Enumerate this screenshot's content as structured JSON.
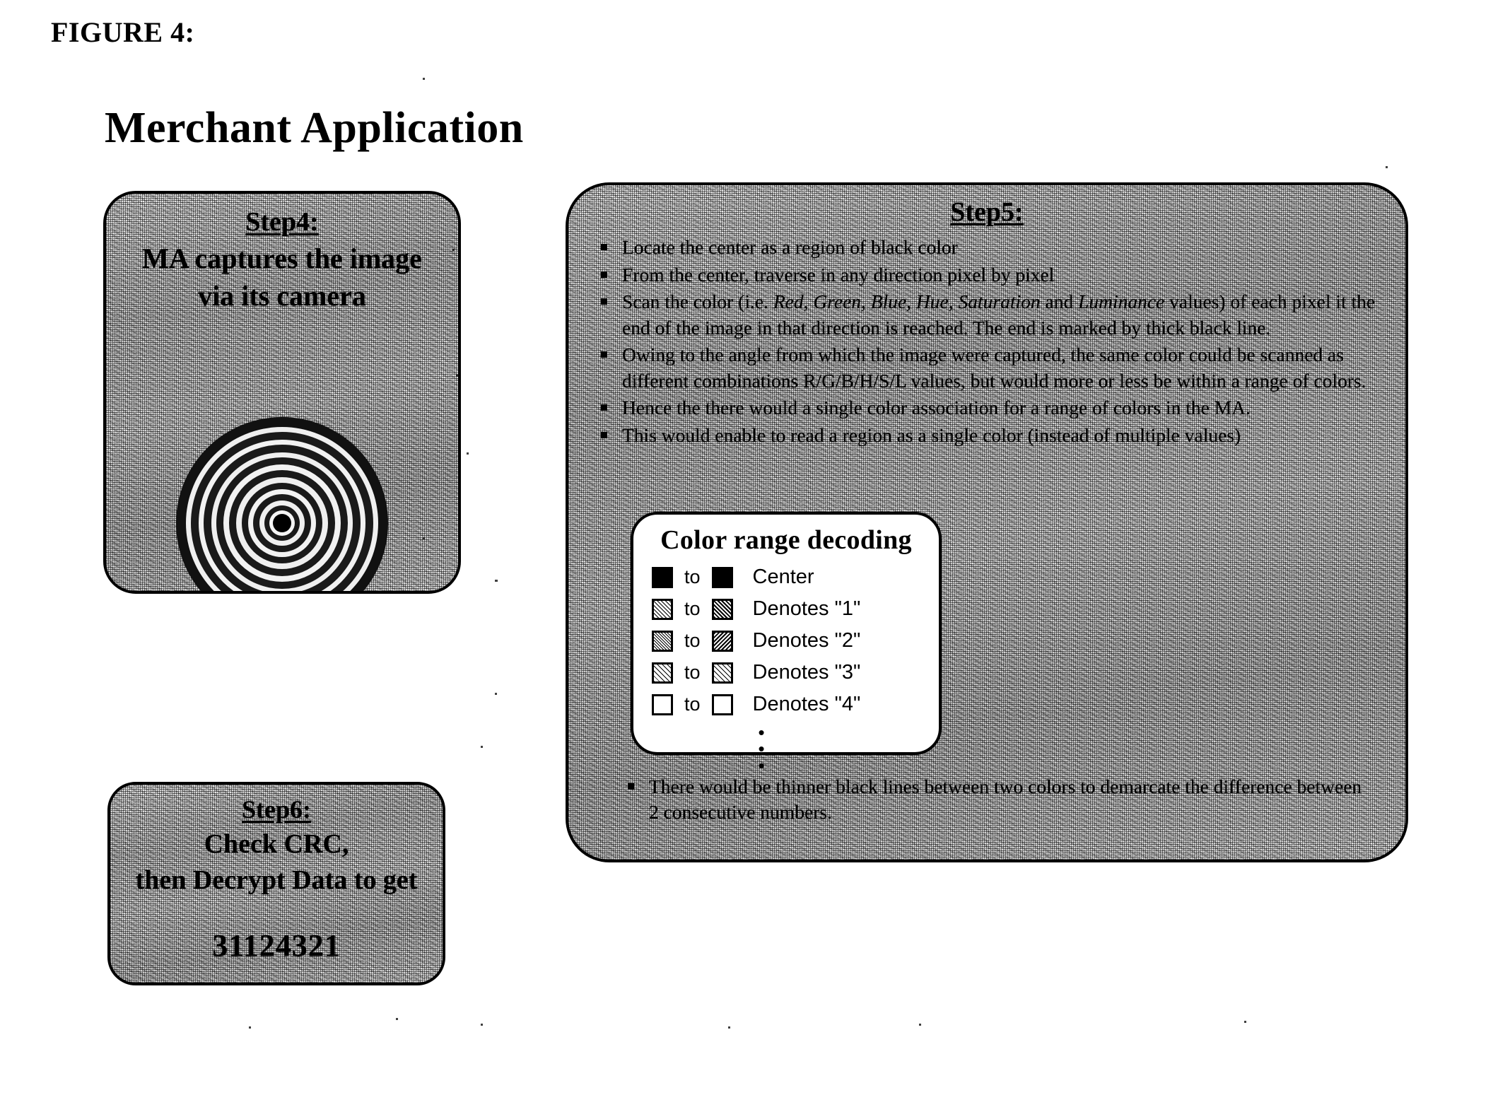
{
  "figure": {
    "label": "FIGURE 4:",
    "title": "Merchant Application"
  },
  "step4": {
    "heading": "Step4:",
    "line1": "MA captures the image",
    "line2": "via its camera",
    "graphic": {
      "icon_name": "concentric-rings-target",
      "center_color": "#000000",
      "ring_count": 11
    }
  },
  "step5": {
    "heading": "Step5:",
    "bullets": [
      {
        "parts": [
          {
            "text": "Locate the center as a region of black color",
            "italic": false
          }
        ]
      },
      {
        "parts": [
          {
            "text": "From the center, traverse in any direction pixel by pixel",
            "italic": false
          }
        ]
      },
      {
        "parts": [
          {
            "text": "Scan the color (i.e. ",
            "italic": false
          },
          {
            "text": "Red, Green, Blue, Hue, Saturation",
            "italic": true
          },
          {
            "text": " and ",
            "italic": false
          },
          {
            "text": "Luminance",
            "italic": true
          },
          {
            "text": " values) of each pixel it the end of the image in that direction is reached. The end is marked by thick black line.",
            "italic": false
          }
        ]
      },
      {
        "parts": [
          {
            "text": "Owing to the angle from which the image were captured, the same color could be scanned as different combinations R/G/B/H/S/L values, but would more or less be within a range of colors.",
            "italic": false
          }
        ]
      },
      {
        "parts": [
          {
            "text": "Hence the there would a single color association for a range of colors in the MA.",
            "italic": false
          }
        ]
      },
      {
        "parts": [
          {
            "text": "This would enable to read a region as a single color (instead of multiple values)",
            "italic": false
          }
        ]
      }
    ],
    "tail_bullets": [
      {
        "parts": [
          {
            "text": "There would be thinner black lines between two colors to demarcate the difference between 2 consecutive numbers.",
            "italic": false
          }
        ]
      }
    ]
  },
  "legend": {
    "title": "Color range decoding",
    "to_label": "to",
    "ellipsis": [
      "•",
      "•",
      "•"
    ],
    "rows": [
      {
        "from_style": "sw-black",
        "to_style": "sw-black",
        "label": "Center"
      },
      {
        "from_style": "sw-d1a",
        "to_style": "sw-d1b",
        "label": "Denotes \"1\""
      },
      {
        "from_style": "sw-d2a",
        "to_style": "sw-d2b",
        "label": "Denotes \"2\""
      },
      {
        "from_style": "sw-d3a",
        "to_style": "sw-d3b",
        "label": "Denotes \"3\""
      },
      {
        "from_style": "sw-white",
        "to_style": "sw-white",
        "label": "Denotes \"4\""
      }
    ]
  },
  "step6": {
    "heading": "Step6:",
    "line1": "Check CRC,",
    "line2": "then Decrypt Data to get",
    "decoded_value": "31124321"
  }
}
